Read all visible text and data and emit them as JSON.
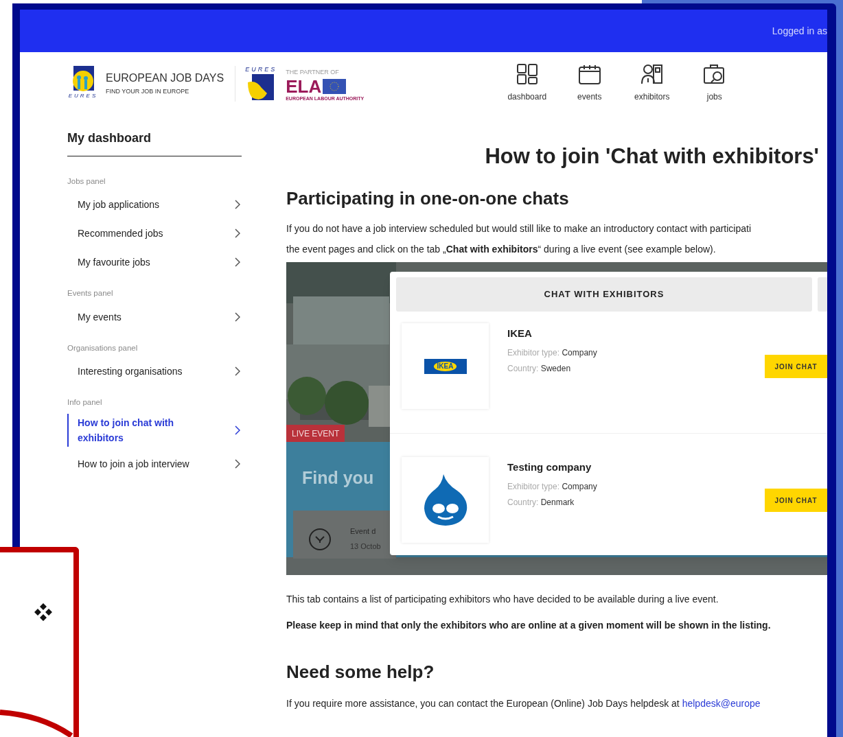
{
  "header": {
    "logged_in": "Logged in as"
  },
  "brand": {
    "logo_word": "EURES",
    "title": "EUROPEAN JOB DAYS",
    "tagline": "FIND YOUR JOB IN EUROPE",
    "eures_word": "EURES",
    "partner_label": "THE PARTNER OF",
    "ela": "ELA",
    "ela_full": "EUROPEAN LABOUR AUTHORITY"
  },
  "nav": [
    {
      "label": "dashboard"
    },
    {
      "label": "events"
    },
    {
      "label": "exhibitors"
    },
    {
      "label": "jobs"
    }
  ],
  "sidebar": {
    "title": "My dashboard",
    "panels": [
      {
        "label": "Jobs panel",
        "items": [
          {
            "label": "My job applications",
            "selected": false
          },
          {
            "label": "Recommended jobs",
            "selected": false
          },
          {
            "label": "My favourite jobs",
            "selected": false
          }
        ]
      },
      {
        "label": "Events panel",
        "items": [
          {
            "label": "My events",
            "selected": false
          }
        ]
      },
      {
        "label": "Organisations panel",
        "items": [
          {
            "label": "Interesting organisations",
            "selected": false
          }
        ]
      },
      {
        "label": "Info panel",
        "items": [
          {
            "label": "How to join chat with exhibitors",
            "selected": true
          },
          {
            "label": "How to join a job interview",
            "selected": false
          }
        ]
      }
    ]
  },
  "main": {
    "heading": "How to join 'Chat with exhibitors'",
    "section_title": "Participating in one-on-one chats",
    "intro_lines": [
      "If you do not have a job interview scheduled but would still like to make an introductory contact with participati",
      "the event pages and click on the tab „**Chat with exhibitors**“ during a live event (see example below)."
    ],
    "figure": {
      "banner": {
        "tag": "LIVE EVENT",
        "headline": "Find you",
        "date_label": "Event d",
        "date": "13 Octob"
      },
      "tab": "CHAT WITH EXHIBITORS",
      "exhibitors": [
        {
          "kind": "wordmark",
          "logo_text": "IKEA",
          "name": "IKEA",
          "type_label": "Exhibitor type:",
          "type": "Company",
          "country_label": "Country:",
          "country": "Sweden",
          "button": "JOIN CHAT"
        },
        {
          "kind": "drop",
          "name": "Testing company",
          "type_label": "Exhibitor type:",
          "type": "Company",
          "country_label": "Country:",
          "country": "Denmark",
          "button": "JOIN CHAT"
        }
      ]
    },
    "note": "This tab contains a list of participating exhibitors who have decided to be available during a live event.",
    "warning": "Please keep in mind that only the exhibitors who are online at a given moment will be shown in the listing.",
    "help_title": "Need some help?",
    "help_text": "If you require more assistance, you can contact the European (Online) Job Days helpdesk at ",
    "help_link": "helpdesk@europe"
  }
}
